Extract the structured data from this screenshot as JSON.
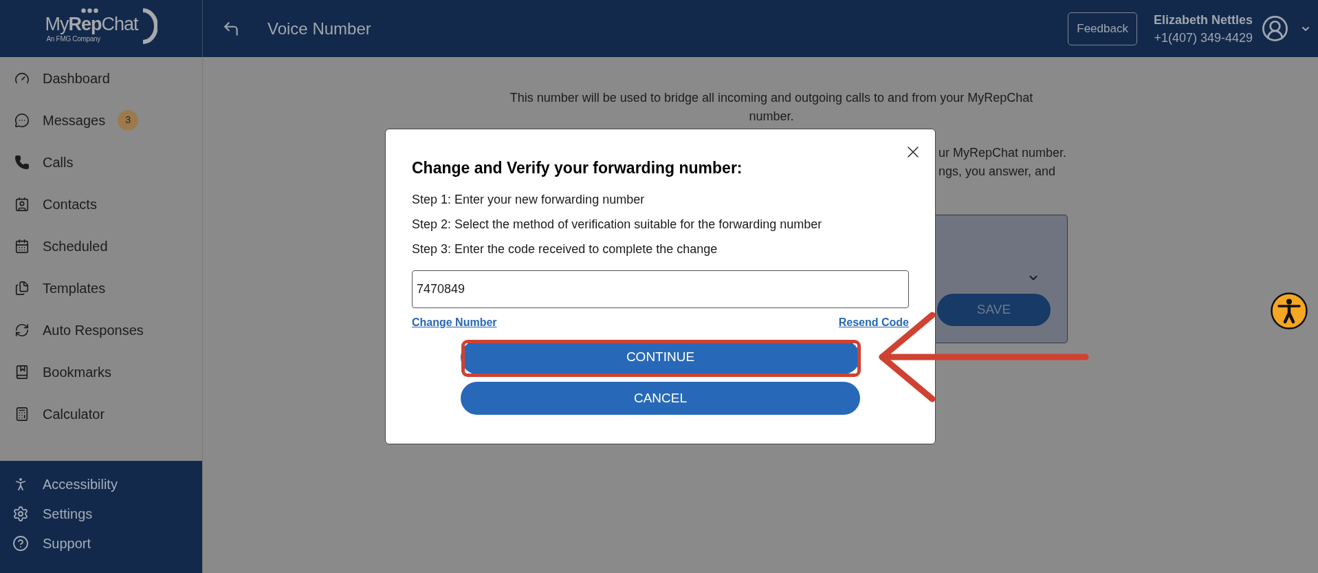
{
  "header": {
    "logo": {
      "wordmark": "My**Rep**Chat",
      "tagline": "An FMG Company"
    },
    "title": "Voice Number",
    "feedback_button": "Feedback",
    "user": {
      "name": "Elizabeth Nettles",
      "phone": "+1(407) 349-4429"
    }
  },
  "sidebar": {
    "items": [
      {
        "label": "Dashboard"
      },
      {
        "label": "Messages",
        "badge": "3"
      },
      {
        "label": "Calls"
      },
      {
        "label": "Contacts"
      },
      {
        "label": "Scheduled"
      },
      {
        "label": "Templates"
      },
      {
        "label": "Auto Responses"
      },
      {
        "label": "Bookmarks"
      },
      {
        "label": "Calculator"
      }
    ],
    "footer_items": [
      {
        "label": "Accessibility"
      },
      {
        "label": "Settings"
      },
      {
        "label": "Support"
      }
    ]
  },
  "page": {
    "intro": "This number will be used to bridge all incoming and outgoing calls to and from your MyRepChat number.",
    "partial_lines": [
      "ur MyRepChat number.",
      "ngs, you answer, and"
    ],
    "panel": {
      "save_button": "SAVE"
    }
  },
  "modal": {
    "title": "Change and Verify your forwarding number:",
    "steps": [
      "Step 1: Enter your new forwarding number",
      "Step 2: Select the method of verification suitable for the forwarding number",
      "Step 3: Enter the code received to complete the change"
    ],
    "code_field": {
      "value": "7470849"
    },
    "links": [
      "Change Number",
      "Resend Code"
    ],
    "buttons": [
      {
        "label": "CONTINUE",
        "highlighted": true
      },
      {
        "label": "CANCEL",
        "highlighted": false
      }
    ]
  }
}
